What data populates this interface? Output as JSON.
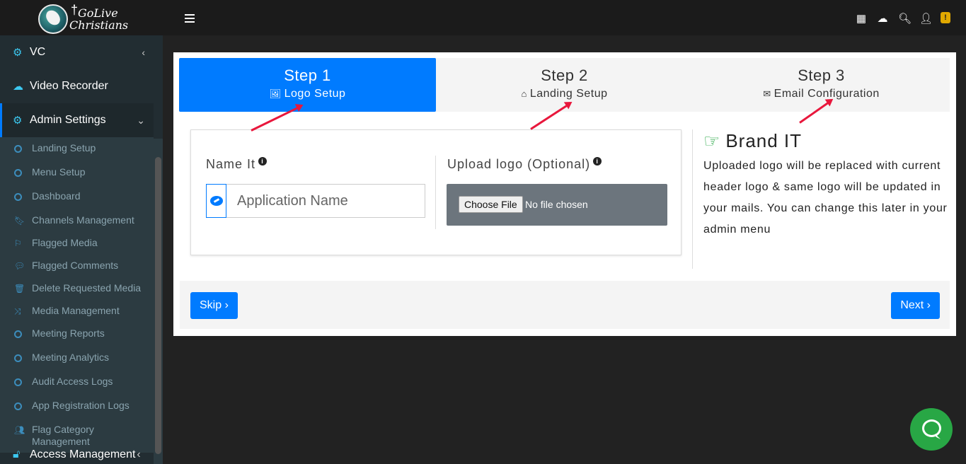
{
  "brand": {
    "line1": "GoLive",
    "line2": "Christians"
  },
  "sidebar": {
    "top_items": [
      {
        "label": "VC",
        "icon": "gears-icon"
      },
      {
        "label": "Video Recorder",
        "icon": "cloud-upload-icon"
      },
      {
        "label": "Admin Settings",
        "icon": "gears-icon"
      }
    ],
    "sub_items": [
      {
        "label": "Landing Setup",
        "icon": "circle-icon"
      },
      {
        "label": "Menu Setup",
        "icon": "circle-icon"
      },
      {
        "label": "Dashboard",
        "icon": "circle-icon"
      },
      {
        "label": "Channels Management",
        "icon": "bookmark-icon"
      },
      {
        "label": "Flagged Media",
        "icon": "flag-icon"
      },
      {
        "label": "Flagged Comments",
        "icon": "comments-icon"
      },
      {
        "label": "Delete Requested Media",
        "icon": "trash-icon"
      },
      {
        "label": "Media Management",
        "icon": "shuffle-icon"
      },
      {
        "label": "Meeting Reports",
        "icon": "circle-icon"
      },
      {
        "label": "Meeting Analytics",
        "icon": "circle-icon"
      },
      {
        "label": "Audit Access Logs",
        "icon": "circle-icon"
      },
      {
        "label": "App Registration Logs",
        "icon": "circle-icon"
      },
      {
        "label": "Flag Category Management",
        "icon": "users-icon"
      }
    ],
    "bottom_item": {
      "label": "Access Management",
      "icon": "unlock-icon"
    }
  },
  "topbar": {
    "icons": [
      "calendar-icon",
      "cloud-upload-icon",
      "search-icon",
      "user-icon",
      "notification-badge-icon"
    ],
    "badge_text": "!"
  },
  "steps": [
    {
      "title": "Step 1",
      "subtitle": "Logo Setup",
      "icon": "image-icon",
      "active": true
    },
    {
      "title": "Step 2",
      "subtitle": "Landing Setup",
      "icon": "home-icon",
      "active": false
    },
    {
      "title": "Step 3",
      "subtitle": "Email Configuration",
      "icon": "envelope-icon",
      "active": false
    }
  ],
  "form": {
    "name_label": "Name It",
    "name_placeholder": "Application Name",
    "upload_label": "Upload logo (Optional)",
    "choose_file_label": "Choose File",
    "no_file_text": "No file chosen"
  },
  "brand_panel": {
    "title": "Brand IT",
    "description": "Uploaded logo will be replaced with current header logo & same logo will be updated in your mails. You can change this later in your admin menu"
  },
  "buttons": {
    "skip": "Skip",
    "next": "Next"
  },
  "colors": {
    "primary": "#007bff",
    "success": "#28a745",
    "sidebar": "#222d32",
    "arrow": "#e8173c"
  }
}
